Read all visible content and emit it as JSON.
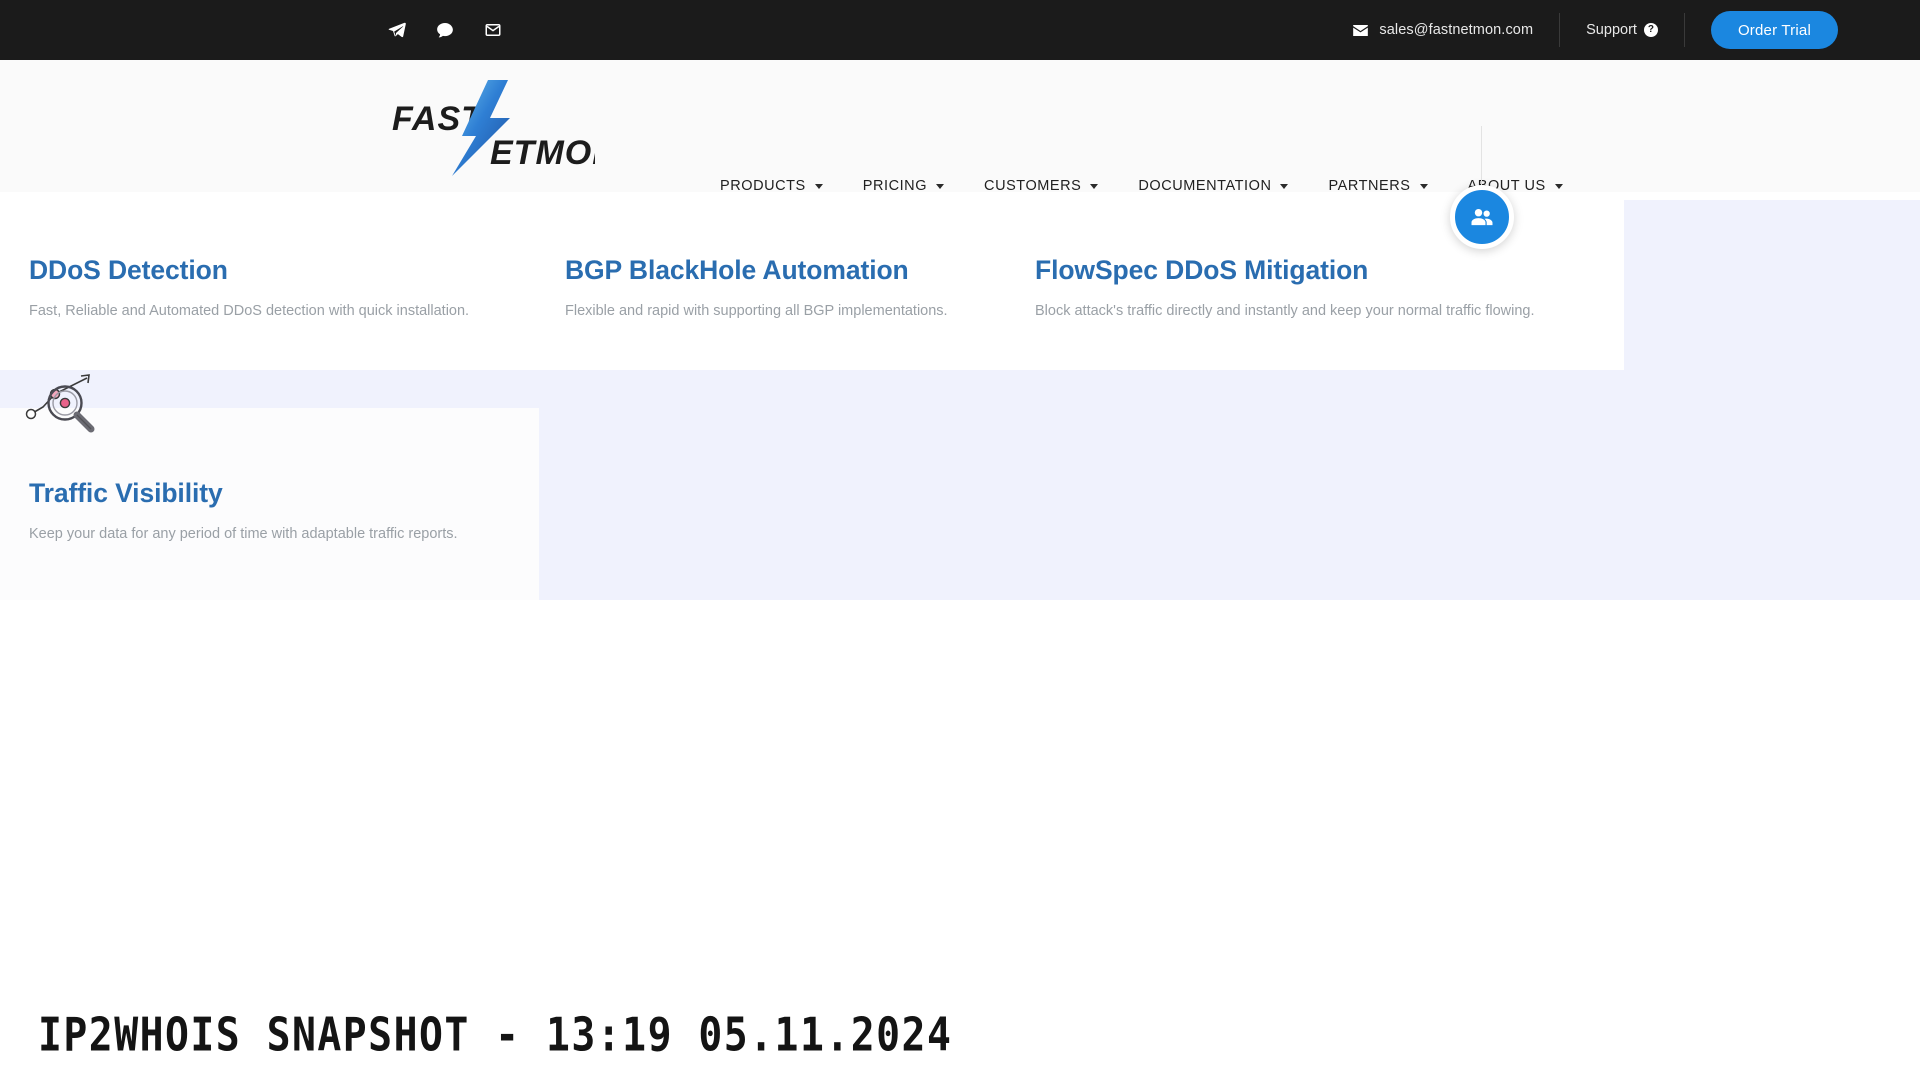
{
  "topbar": {
    "social": [
      {
        "name": "telegram-icon",
        "label": "Telegram"
      },
      {
        "name": "chat-icon",
        "label": "Chat"
      },
      {
        "name": "mail-icon",
        "label": "Mail"
      }
    ],
    "email": "sales@fastnetmon.com",
    "support_label": "Support",
    "support_icon_glyph": "?",
    "order_trial_label": "Order Trial",
    "background_color": "#1b1b1b",
    "accent_color": "#1b87e0"
  },
  "header": {
    "logo_text_1": "FAST",
    "logo_text_2": "NETMON",
    "nav": [
      {
        "label": "PRODUCTS",
        "has_dropdown": true
      },
      {
        "label": "PRICING",
        "has_dropdown": true
      },
      {
        "label": "CUSTOMERS",
        "has_dropdown": true
      },
      {
        "label": "DOCUMENTATION",
        "has_dropdown": true
      },
      {
        "label": "PARTNERS",
        "has_dropdown": true
      },
      {
        "label": "ABOUT US",
        "has_dropdown": true
      }
    ]
  },
  "floating_button": {
    "name": "community-users-button",
    "color": "#1b87e0"
  },
  "cards": [
    {
      "title": "DDoS Detection",
      "description": "Fast, Reliable and Automated DDoS detection with quick installation."
    },
    {
      "title": "BGP BlackHole Automation",
      "description": "Flexible and rapid with supporting all BGP implementations."
    },
    {
      "title": "FlowSpec DDoS Mitigation",
      "description": "Block attack's traffic directly and instantly and keep your normal traffic flowing."
    },
    {
      "title": "Traffic Visibility",
      "description": "Keep your data for any period of time with adaptable traffic reports."
    }
  ],
  "title_color": "#2a6db0",
  "description_color": "#9aa0a6",
  "watermark": "IP2WHOIS SNAPSHOT - 13:19 05.11.2024"
}
